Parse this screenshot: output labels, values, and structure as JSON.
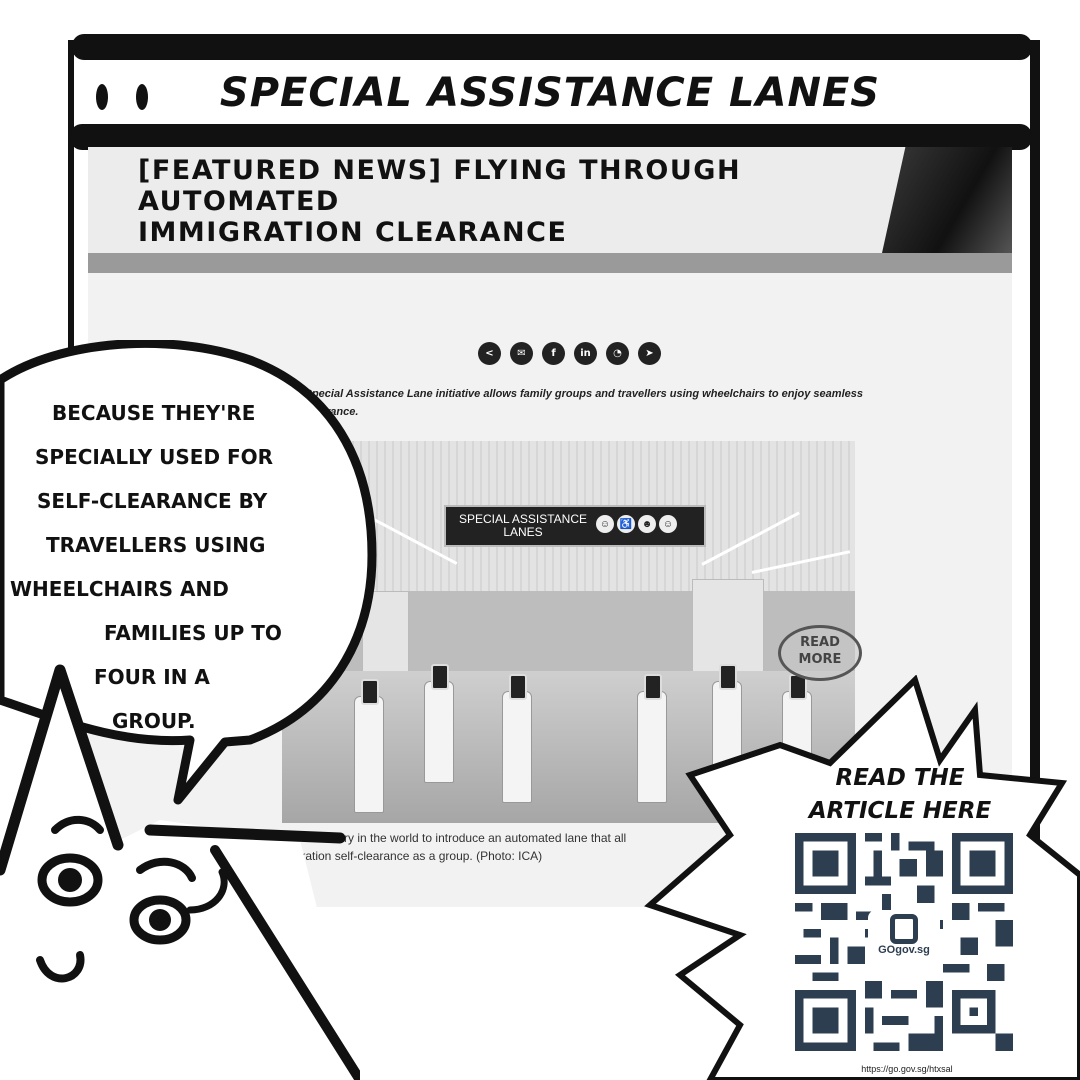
{
  "window": {
    "title": "SPECIAL ASSISTANCE LANES"
  },
  "article": {
    "headline_line1": "[FEATURED NEWS] FLYING THROUGH AUTOMATED",
    "headline_line2": "IMMIGRATION CLEARANCE",
    "share_icons": [
      "share-icon",
      "email-icon",
      "facebook-icon",
      "linkedin-icon",
      "whatsapp-icon",
      "telegram-icon"
    ],
    "share_glyphs": [
      "<",
      "✉",
      "f",
      "in",
      "◔",
      "➤"
    ],
    "intro_line1": "The Special Assistance Lane initiative allows family groups and travellers using wheelchairs to enjoy seamless",
    "intro_line2": "self-clearance.",
    "photo_sign_line1": "SPECIAL ASSISTANCE",
    "photo_sign_line2": "LANES",
    "caption_line1": "e first country in the world to introduce an automated lane that all",
    "caption_line2": "migration self-clearance as a group. (Photo: ICA)",
    "read_more_line1": "READ",
    "read_more_line2": "MORE"
  },
  "bubble": {
    "lines": [
      "BECAUSE THEY'RE",
      "SPECIALLY USED FOR",
      "SELF-CLEARANCE BY",
      "TRAVELLERS USING",
      "WHEELCHAIRS AND",
      "FAMILIES UP TO",
      "FOUR IN A",
      "GROUP."
    ]
  },
  "qr": {
    "heading_line1": "READ THE",
    "heading_line2": "ARTICLE HERE",
    "logo_text": "GOgov.sg",
    "url": "https://go.gov.sg/htxsal"
  },
  "colors": {
    "ink": "#111111",
    "qr_dark": "#2c3e50",
    "page_bg": "#f2f2f2"
  }
}
